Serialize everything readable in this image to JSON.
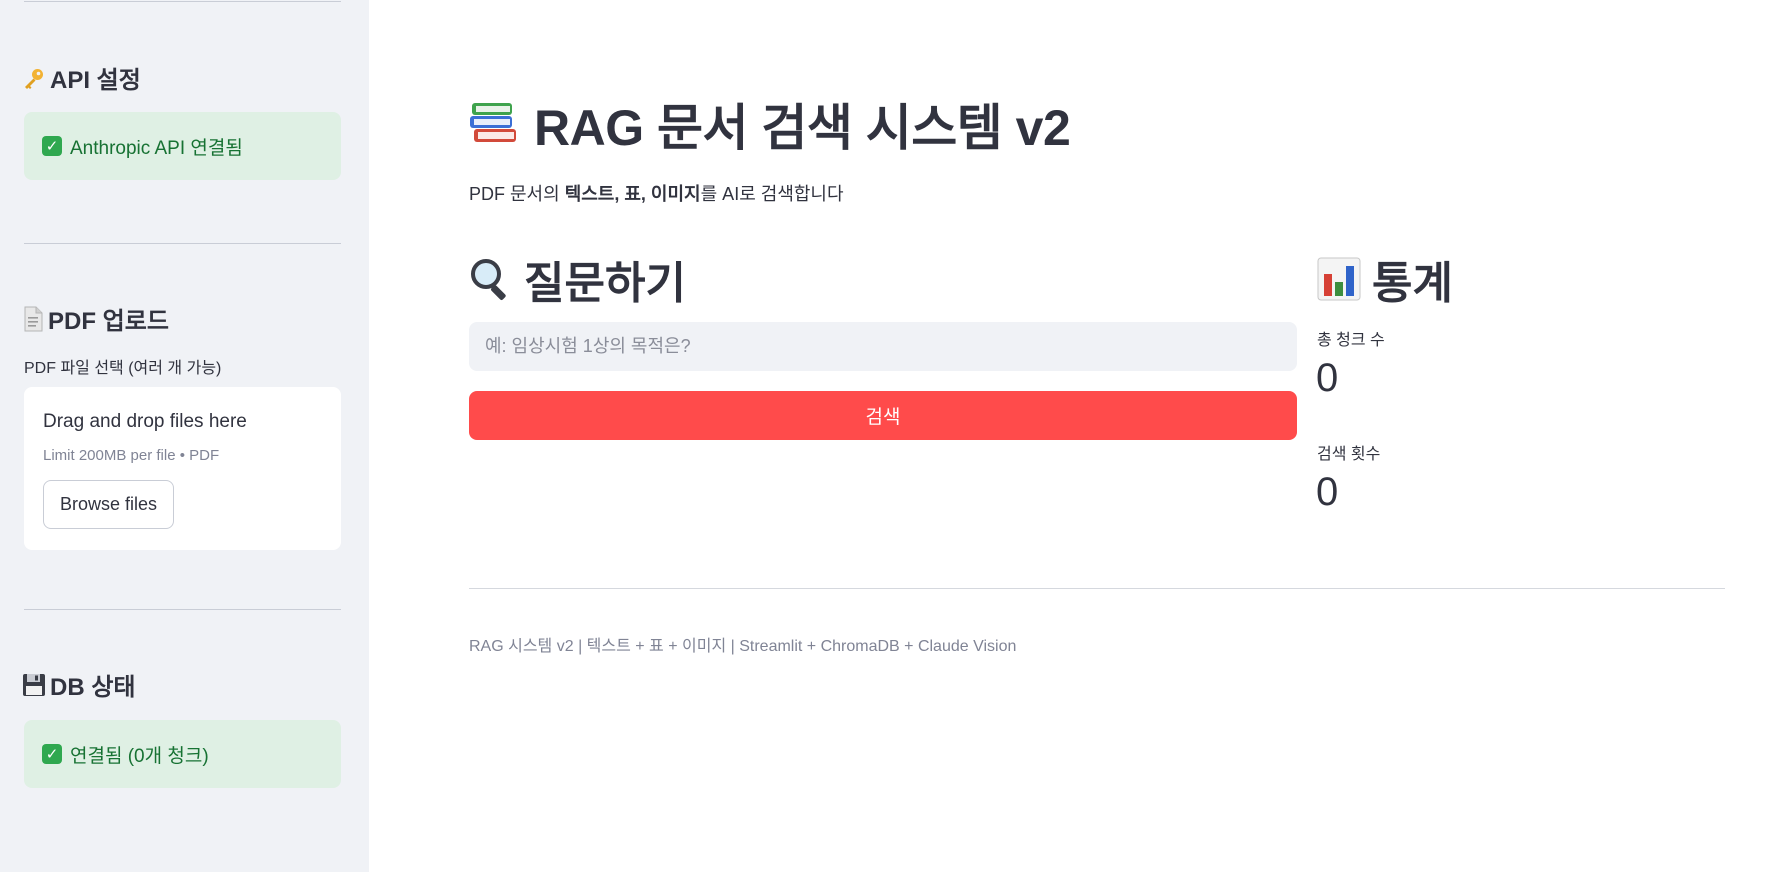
{
  "sidebar": {
    "api_section": {
      "title": "API 설정",
      "status": "Anthropic API 연결됨",
      "icon": "key-icon"
    },
    "upload_section": {
      "title": "PDF 업로드",
      "icon": "page-icon",
      "uploader_label": "PDF 파일 선택 (여러 개 가능)",
      "dropzone_title": "Drag and drop files here",
      "dropzone_limit": "Limit 200MB per file • PDF",
      "browse_label": "Browse files"
    },
    "db_section": {
      "title": "DB 상태",
      "icon": "floppy-disk-icon",
      "status": "연결됨 (0개 청크)"
    }
  },
  "main": {
    "title": "RAG 문서 검색 시스템 v2",
    "title_icon": "books-icon",
    "subtitle": {
      "prefix": "PDF 문서의 ",
      "bold": "텍스트, 표, 이미지",
      "suffix": "를 AI로 검색합니다"
    },
    "query": {
      "heading": "질문하기",
      "icon": "magnifier-icon",
      "placeholder": "예: 임상시험 1상의 목적은?",
      "value": "",
      "button_label": "검색"
    },
    "stats": {
      "heading": "통계",
      "icon": "bar-chart-icon",
      "metrics": [
        {
          "label": "총 청크 수",
          "value": "0"
        },
        {
          "label": "검색 횟수",
          "value": "0"
        }
      ]
    },
    "footer": "RAG 시스템 v2 | 텍스트 + 표 + 이미지 | Streamlit + ChromaDB + Claude Vision"
  },
  "colors": {
    "sidebar_bg": "#f0f2f6",
    "success_bg": "#dff0e4",
    "success_text": "#177233",
    "primary": "#ff4b4b",
    "text": "#31333f"
  }
}
